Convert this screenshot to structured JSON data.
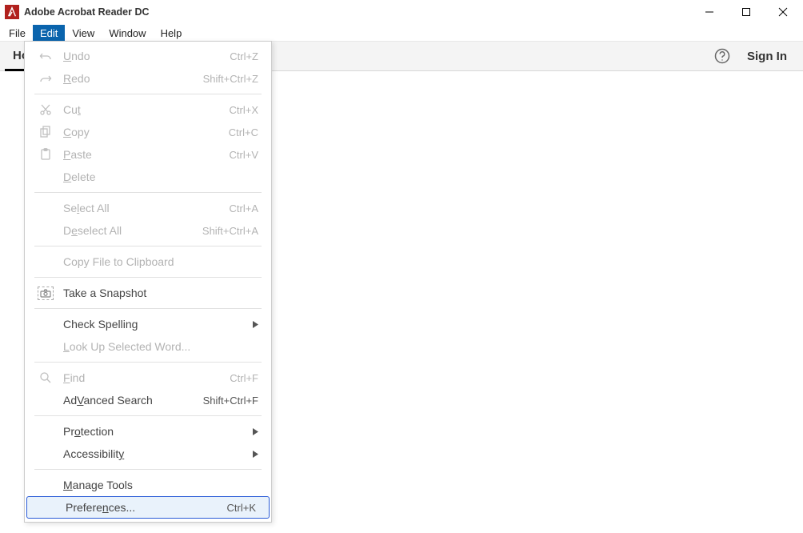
{
  "titlebar": {
    "title": "Adobe Acrobat Reader DC"
  },
  "menubar": {
    "file": "File",
    "edit": "Edit",
    "view": "View",
    "window": "Window",
    "help": "Help"
  },
  "toolbar": {
    "home": "Ho",
    "signin": "Sign In"
  },
  "edit_menu": {
    "undo": {
      "label": "Undo",
      "u": "U",
      "rest": "ndo",
      "shortcut": "Ctrl+Z"
    },
    "redo": {
      "label": "Redo",
      "u": "R",
      "rest": "edo",
      "shortcut": "Shift+Ctrl+Z"
    },
    "cut": {
      "label": "Cut",
      "u": "t",
      "pre": "Cu",
      "shortcut": "Ctrl+X"
    },
    "copy": {
      "label": "Copy",
      "u": "C",
      "rest": "opy",
      "shortcut": "Ctrl+C"
    },
    "paste": {
      "label": "Paste",
      "u": "P",
      "rest": "aste",
      "shortcut": "Ctrl+V"
    },
    "delete": {
      "label": "Delete",
      "u": "D",
      "rest": "elete"
    },
    "select_all": {
      "label": "Select All",
      "u": "l",
      "pre": "Se",
      "rest": "ect All",
      "shortcut": "Ctrl+A"
    },
    "deselect_all": {
      "label": "Deselect All",
      "u": "e",
      "pre": "D",
      "rest": "select All",
      "shortcut": "Shift+Ctrl+A"
    },
    "copy_file": {
      "label": "Copy File to Clipboard"
    },
    "snapshot": {
      "label": "Take a Snapshot"
    },
    "spelling": {
      "label": "Check Spelling",
      "u": "g",
      "pre": "Check Spellin"
    },
    "lookup": {
      "label": "Look Up Selected Word...",
      "u": "L",
      "rest": "ook Up Selected Word..."
    },
    "find": {
      "label": "Find",
      "u": "F",
      "rest": "ind",
      "shortcut": "Ctrl+F"
    },
    "adv_search": {
      "label": "Advanced Search",
      "u": "V",
      "pre": "Ad",
      "rest": "anced Search",
      "shortcut": "Shift+Ctrl+F"
    },
    "protection": {
      "label": "Protection",
      "u": "o",
      "pre": "Pr",
      "rest": "tection"
    },
    "accessibility": {
      "label": "Accessibility",
      "u": "y",
      "pre": "Accessibilit"
    },
    "manage_tools": {
      "label": "Manage Tools",
      "u": "M",
      "rest": "anage Tools"
    },
    "preferences": {
      "label": "Preferences...",
      "u": "n",
      "pre": "Prefere",
      "rest": "ces...",
      "shortcut": "Ctrl+K"
    }
  }
}
